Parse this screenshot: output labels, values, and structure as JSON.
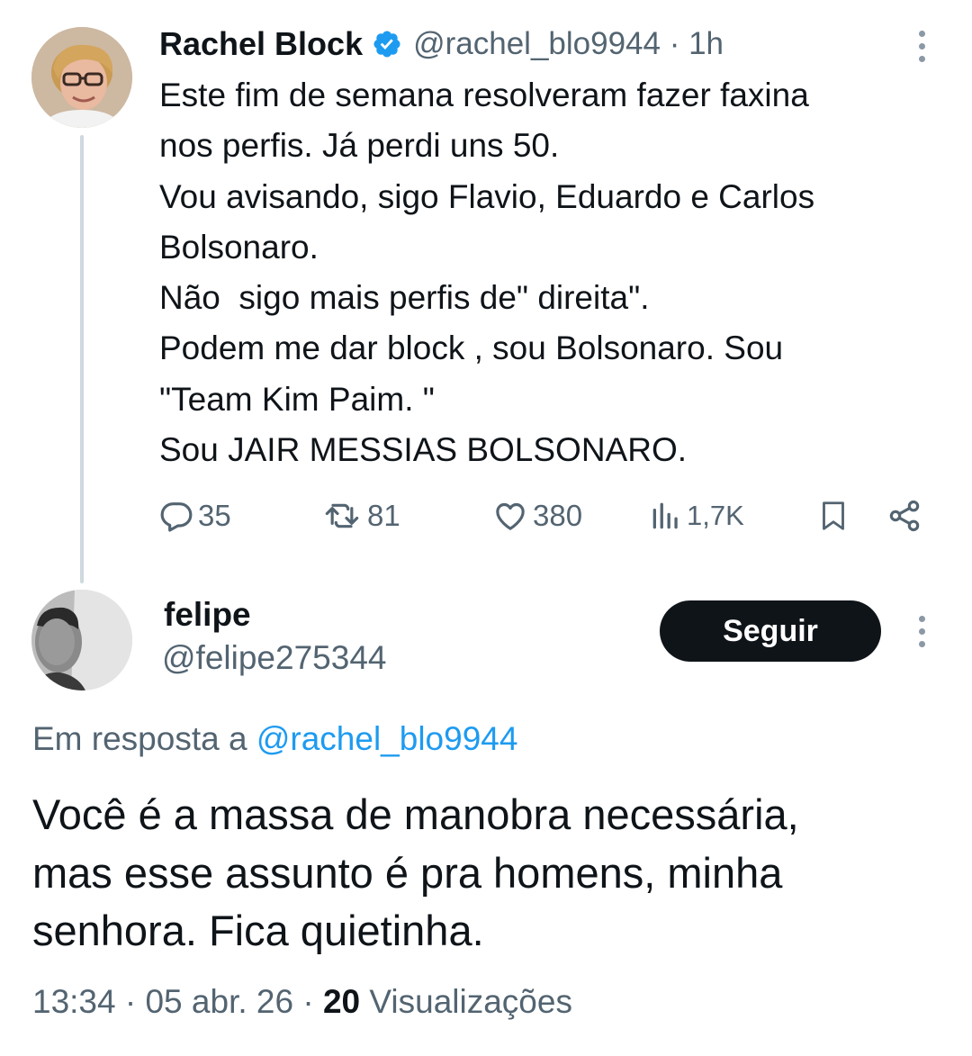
{
  "tweet": {
    "author": {
      "display_name": "Rachel Block",
      "handle": "@rachel_blo9944",
      "time": "1h",
      "verified": true
    },
    "text_lines": [
      "Este fim de semana resolveram fazer faxina",
      "nos perfis. Já perdi uns 50.",
      "Vou avisando, sigo Flavio, Eduardo e Carlos",
      "Bolsonaro.",
      "Não  sigo mais perfis de\" direita\".",
      "Podem me dar block , sou Bolsonaro. Sou",
      "\"Team Kim Paim. \"",
      "Sou JAIR MESSIAS BOLSONARO."
    ],
    "stats": {
      "replies": "35",
      "retweets": "81",
      "likes": "380",
      "views": "1,7K"
    }
  },
  "reply": {
    "author": {
      "display_name": "felipe",
      "handle": "@felipe275344"
    },
    "follow_label": "Seguir",
    "reply_to_prefix": "Em resposta a",
    "reply_to_handle": "@rachel_blo9944",
    "text_lines": [
      "Você é a massa de manobra necessária,",
      "mas esse assunto é pra homens, minha",
      "senhora. Fica quietinha."
    ],
    "time": "13:34",
    "date": "05 abr. 26",
    "views_count": "20",
    "views_label": "Visualizações"
  },
  "colors": {
    "text": "#0f1419",
    "secondary": "#536471",
    "link": "#1d9bf0",
    "verified": "#1d9bf0",
    "button_bg": "#0f1419",
    "thread_line": "#cfd9de"
  },
  "icons": [
    "verified-badge-icon",
    "more-options-icon",
    "reply-icon",
    "retweet-icon",
    "like-icon",
    "views-icon",
    "bookmark-icon",
    "share-icon"
  ]
}
